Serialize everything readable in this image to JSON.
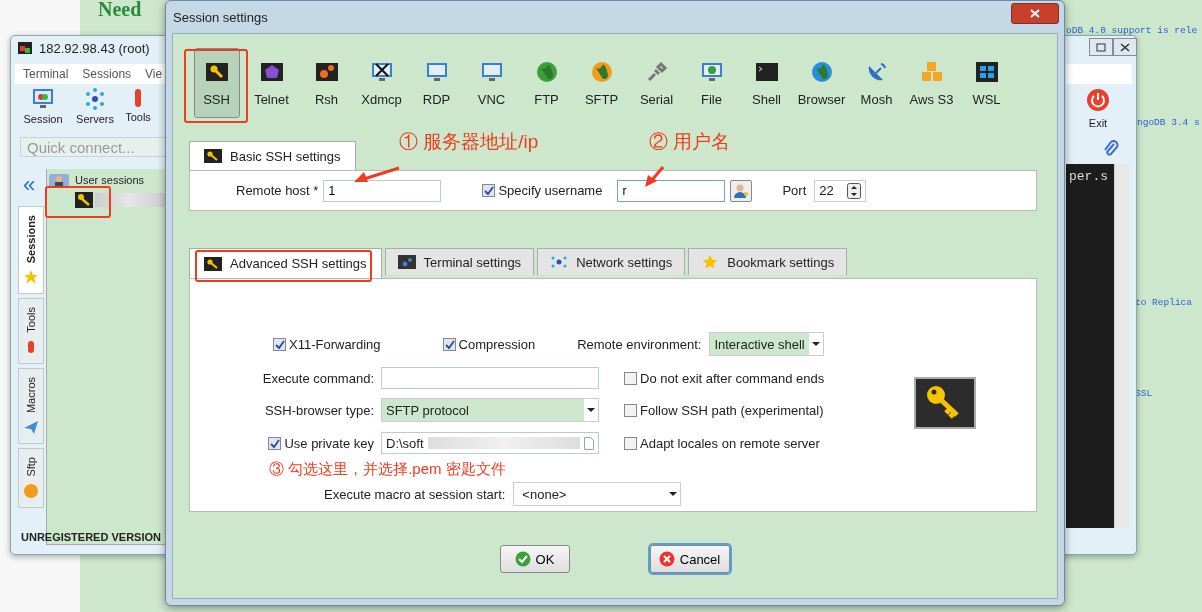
{
  "background": {
    "heading": "Need",
    "notes": [
      "oDB 4.0 support is rele",
      "ngoDB 3.4 s",
      "to Replica",
      "SSL"
    ]
  },
  "main_window": {
    "title": "182.92.98.43 (root)",
    "menu": [
      "Terminal",
      "Sessions",
      "Vie"
    ],
    "toolbar": [
      "Session",
      "Servers",
      "Tools"
    ],
    "exit_button": "Exit",
    "quick_connect": {
      "placeholder": "Quick connect..."
    },
    "collapse": "«",
    "sessions_folder": "User sessions",
    "side_tabs": [
      {
        "label": "Sessions",
        "selected": true
      },
      {
        "label": "Tools",
        "selected": false
      },
      {
        "label": "Macros",
        "selected": false
      },
      {
        "label": "Sftp",
        "selected": false
      }
    ],
    "terminal_text": "per.s",
    "status": "UNREGISTERED VERSION"
  },
  "dialog": {
    "title": "Session settings",
    "session_types": [
      {
        "label": "SSH",
        "selected": true
      },
      {
        "label": "Telnet",
        "selected": false
      },
      {
        "label": "Rsh",
        "selected": false
      },
      {
        "label": "Xdmcp",
        "selected": false
      },
      {
        "label": "RDP",
        "selected": false
      },
      {
        "label": "VNC",
        "selected": false
      },
      {
        "label": "FTP",
        "selected": false
      },
      {
        "label": "SFTP",
        "selected": false
      },
      {
        "label": "Serial",
        "selected": false
      },
      {
        "label": "File",
        "selected": false
      },
      {
        "label": "Shell",
        "selected": false
      },
      {
        "label": "Browser",
        "selected": false
      },
      {
        "label": "Mosh",
        "selected": false
      },
      {
        "label": "Aws S3",
        "selected": false
      },
      {
        "label": "WSL",
        "selected": false
      }
    ],
    "annotations": [
      "① 服务器地址/ip",
      "② 用户名",
      "③ 勾选这里，并选择.pem 密匙文件"
    ],
    "basic_tab": "Basic SSH settings",
    "remote_host": {
      "label": "Remote host *",
      "value": "1"
    },
    "specify_username": {
      "label": "Specify username",
      "checked": true,
      "value": "r"
    },
    "port": {
      "label": "Port",
      "value": "22"
    },
    "tabs": [
      {
        "label": "Advanced SSH settings",
        "selected": true
      },
      {
        "label": "Terminal settings",
        "selected": false
      },
      {
        "label": "Network settings",
        "selected": false
      },
      {
        "label": "Bookmark settings",
        "selected": false
      }
    ],
    "x11": {
      "label": "X11-Forwarding",
      "checked": true
    },
    "compression": {
      "label": "Compression",
      "checked": true
    },
    "remote_env": {
      "label": "Remote environment:",
      "value": "Interactive shell"
    },
    "execute_command": {
      "label": "Execute command:"
    },
    "no_exit": {
      "label": "Do not exit after command ends",
      "checked": false
    },
    "browser_type": {
      "label": "SSH-browser type:",
      "value": "SFTP protocol"
    },
    "follow_path": {
      "label": "Follow SSH path (experimental)",
      "checked": false
    },
    "private_key": {
      "label": "Use private key",
      "checked": true,
      "value": "D:\\soft"
    },
    "adapt_locales": {
      "label": "Adapt locales on remote server",
      "checked": false
    },
    "macro": {
      "label": "Execute macro at session start:",
      "value": "<none>"
    },
    "buttons": [
      {
        "label": "OK",
        "kind": "ok"
      },
      {
        "label": "Cancel",
        "kind": "cancel"
      }
    ]
  }
}
